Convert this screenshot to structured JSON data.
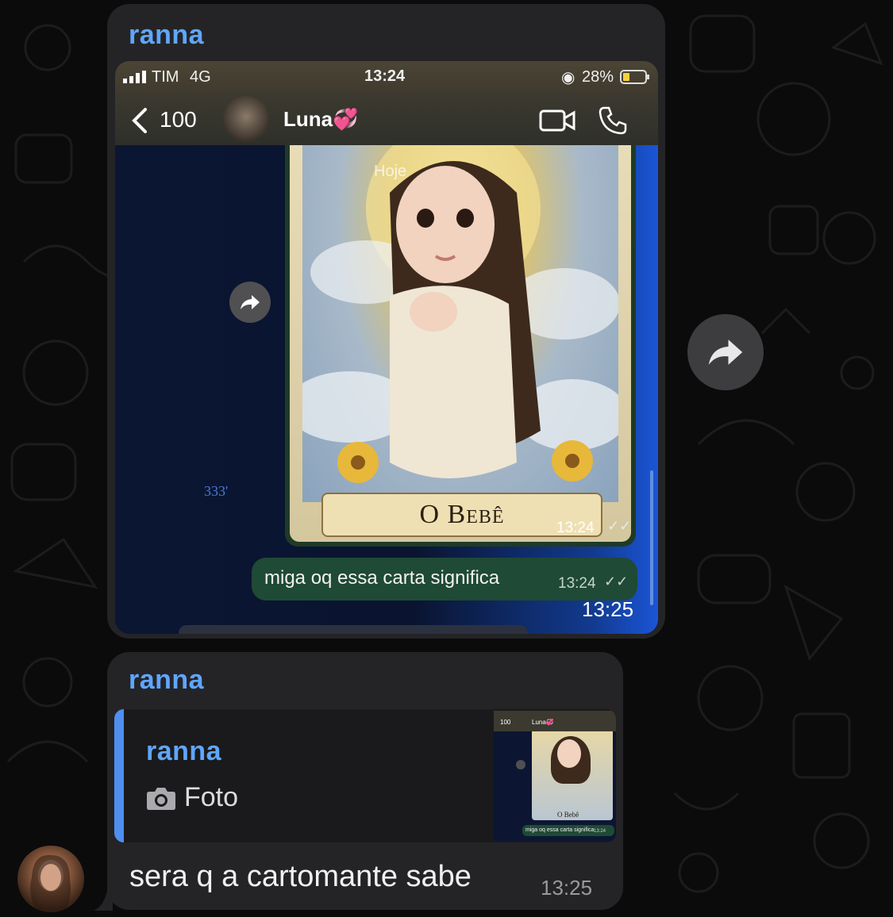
{
  "messages": [
    {
      "sender": "ranna",
      "screenshot": {
        "status": {
          "carrier": "TIM",
          "network": "4G",
          "time": "13:24",
          "battery": "28%"
        },
        "chat_header": {
          "back_count": "100",
          "contact_name": "Luna💞"
        },
        "date_overlay": "Hoje",
        "card_title": "O Bebê",
        "card_time": "13:24",
        "sent_text": "miga oq essa carta significa",
        "sent_time": "13:24",
        "side_label": "333'"
      },
      "time": "13:25"
    },
    {
      "sender": "ranna",
      "reply": {
        "sender": "ranna",
        "label": "Foto"
      },
      "thumb": {
        "back": "100",
        "contact": "Luna💞",
        "card_title": "O Bebê",
        "msg": "miga oq essa carta significa",
        "time": "13:24"
      },
      "text": "sera q a cartomante sabe",
      "time": "13:25"
    }
  ],
  "colors": {
    "sender": "#5fa6ff",
    "bubble": "#242426",
    "accent_bar": "#4f8ff0",
    "sent_green": "#1f4a35"
  },
  "icons": [
    "forward-icon",
    "camera-icon",
    "video-call-icon",
    "phone-icon",
    "back-chevron-icon",
    "signal-icon",
    "battery-icon"
  ]
}
